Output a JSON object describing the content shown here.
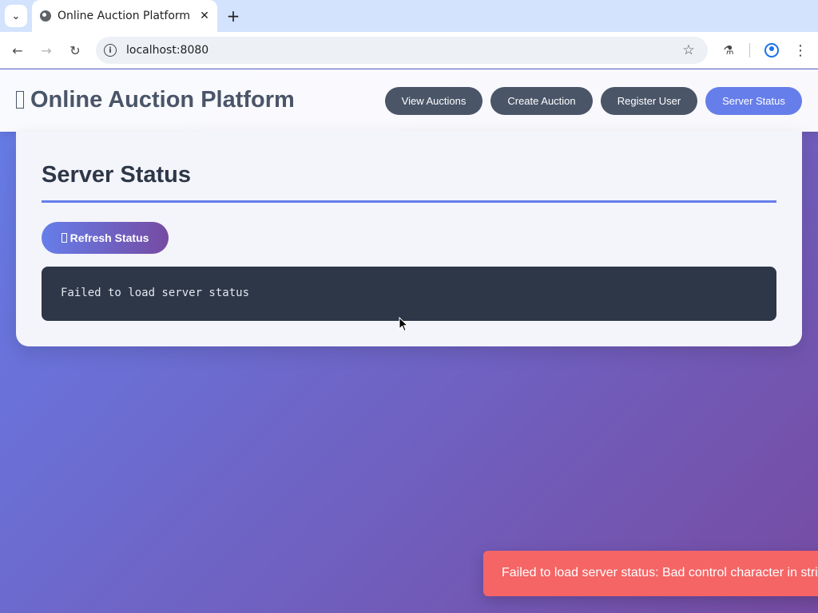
{
  "browser": {
    "tab_title": "Online Auction Platform",
    "url": "localhost:8080"
  },
  "header": {
    "title": "Online Auction Platform",
    "nav": [
      {
        "label": "View Auctions"
      },
      {
        "label": "Create Auction"
      },
      {
        "label": "Register User"
      },
      {
        "label": "Server Status",
        "active": true
      }
    ]
  },
  "main": {
    "title": "Server Status",
    "refresh_label": "Refresh Status",
    "status_output": "Failed to load server status"
  },
  "toast": {
    "message": "Failed to load server status: Bad control character in string literal in JSON at position"
  },
  "colors": {
    "accent": "#667eea",
    "gradient_end": "#764ba2",
    "nav_pill": "#4a5568",
    "code_bg": "#2d3748",
    "toast_error": "#f56565"
  }
}
